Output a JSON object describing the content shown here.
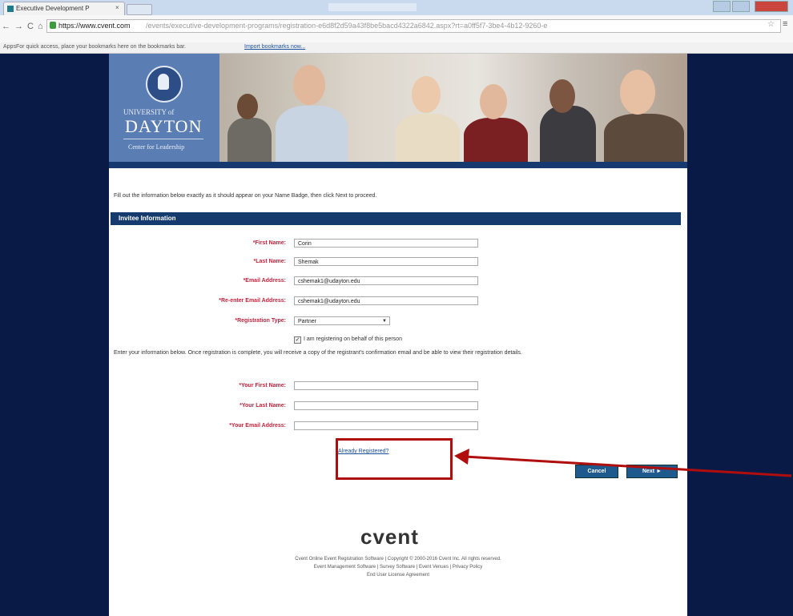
{
  "browser": {
    "tab_title": "Executive Development P",
    "tab_close": "×",
    "url_host": "https://www.cvent.com",
    "url_path": "/events/executive-development-programs/registration-e6d8f2d59a43f8be5bacd4322a6842.aspx?rt=a0ff5f7-3be4-4b12-9260-e",
    "apps_label": "Apps",
    "bookmarks_text": "For quick access, place your bookmarks here on the bookmarks bar.",
    "bookmarks_link": "Import bookmarks now..."
  },
  "banner": {
    "univ_line": "UNIVERSITY of",
    "dayton": "DAYTON",
    "center": "Center for Leadership"
  },
  "form": {
    "instruction": "Fill out the information below exactly as it should appear on your Name Badge, then click Next to proceed.",
    "section_title": "Invitee Information",
    "first_name_label": "*First Name:",
    "first_name_value": "Corin",
    "last_name_label": "*Last Name:",
    "last_name_value": "Shemak",
    "email_label": "*Email Address:",
    "email_value": "cshemak1@udayton.edu",
    "reemail_label": "*Re-enter Email Address:",
    "reemail_value": "cshemak1@udayton.edu",
    "regtype_label": "*Registration Type:",
    "regtype_value": "Partner",
    "behalf_check": "✓",
    "behalf_label": "I am registering on behalf of this person",
    "info_text": "Enter your information below. Once registration is complete, you will receive a copy of the registrant's confirmation email and be able to view their registration details.",
    "your_first_label": "*Your First Name:",
    "your_last_label": "*Your Last Name:",
    "your_email_label": "*Your Email Address:",
    "already_registered": "Already Registered?",
    "cancel": "Cancel",
    "next": "Next ►"
  },
  "footer": {
    "logo": "cvent",
    "line1": "Cvent Online Event Registration Software  |  Copyright © 2000-2016 Cvent Inc. All rights reserved.",
    "line2": "Event Management Software  |  Survey Software  |  Event Venues  |  Privacy Policy",
    "line3": "End User License Agreement"
  },
  "colors": {
    "page_bg": "#0a1a47",
    "section_header": "#143a6e",
    "required_label": "#c0243c",
    "annotation": "#b00d0d"
  }
}
